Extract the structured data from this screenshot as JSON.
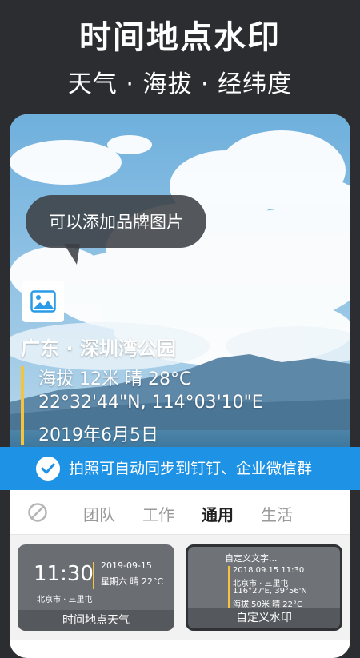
{
  "header": {
    "title": "时间地点水印",
    "subtitle": "天气 · 海拔 · 经纬度"
  },
  "photo": {
    "bubble_text": "可以添加品牌图片",
    "location": "广东 · 深圳湾公园",
    "altitude_weather": "海拔 12米   晴 28°C",
    "coordinates": "22°32'44\"N, 114°03'10\"E",
    "date": "2019年6月5日"
  },
  "banner": {
    "text": "拍照可自动同步到钉钉、企业微信群"
  },
  "tabs": [
    "团队",
    "工作",
    "通用",
    "生活"
  ],
  "active_tab": "通用",
  "templates": [
    {
      "name": "时间地点天气",
      "time": "11:30",
      "date": "2019-09-15",
      "week_weather": "星期六 晴 22°C",
      "location": "北京市 · 三里屯"
    },
    {
      "name": "自定义水印",
      "title": "自定义文字...",
      "lines": [
        "2018.09.15 11:30",
        "北京市 · 三里屯",
        "116°27'E, 39°56'N",
        "海拔 50米  晴 22°C"
      ]
    }
  ],
  "colors": {
    "accent": "#1e93e6",
    "highlight": "#f6c43c",
    "background": "#2b2d31"
  }
}
